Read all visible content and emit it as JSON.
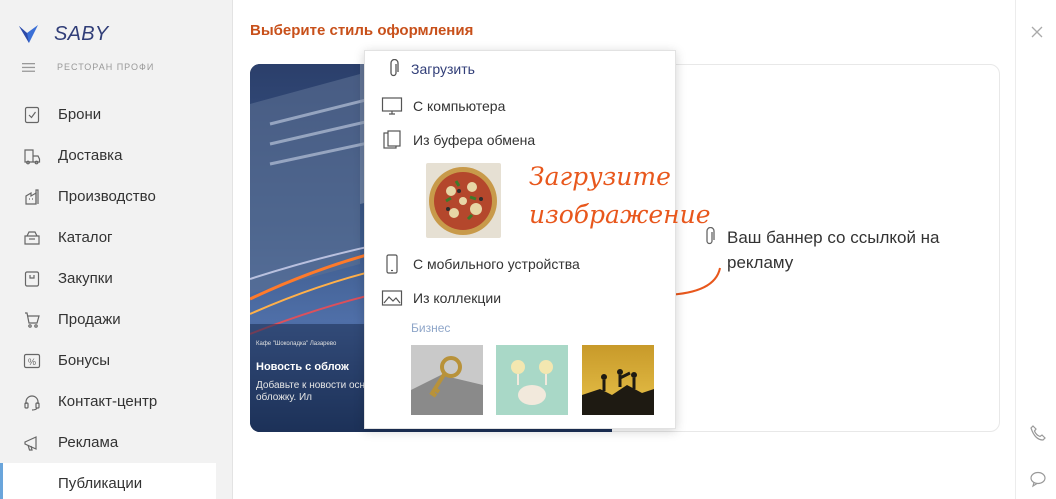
{
  "app": {
    "logo_text": "SABY",
    "org_name": "РЕСТОРАН ПРОФИ"
  },
  "sidebar": {
    "items": [
      {
        "label": "Брони",
        "icon": "calendar-check-icon"
      },
      {
        "label": "Доставка",
        "icon": "delivery-bag-icon"
      },
      {
        "label": "Производство",
        "icon": "production-icon"
      },
      {
        "label": "Каталог",
        "icon": "catalog-box-icon"
      },
      {
        "label": "Закупки",
        "icon": "purchases-icon"
      },
      {
        "label": "Продажи",
        "icon": "cart-icon"
      },
      {
        "label": "Бонусы",
        "icon": "percent-icon"
      },
      {
        "label": "Контакт-центр",
        "icon": "headset-icon"
      },
      {
        "label": "Реклама",
        "icon": "megaphone-icon"
      }
    ],
    "active_subitem": "Публикации"
  },
  "main": {
    "title": "Выберите стиль оформления"
  },
  "banner": {
    "meta": "Кафе \"Шоколадка\"   Лазарево",
    "title": "Новость с облож",
    "text": "Добавьте к новости основе обложку. Ил"
  },
  "hint": {
    "text": "Ваш баннер со ссылкой на рекламу"
  },
  "popup": {
    "upload_label": "Загрузить",
    "from_computer": "С компьютера",
    "from_clipboard": "Из буфера обмена",
    "annotation": "Загрузите изображение",
    "from_mobile": "С мобильного устройства",
    "from_collection": "Из коллекции",
    "group_label": "Бизнес"
  },
  "colors": {
    "accent": "#c8501a",
    "brand": "#313e78",
    "annotation": "#e8571c",
    "active_bar": "#6aa5db"
  }
}
